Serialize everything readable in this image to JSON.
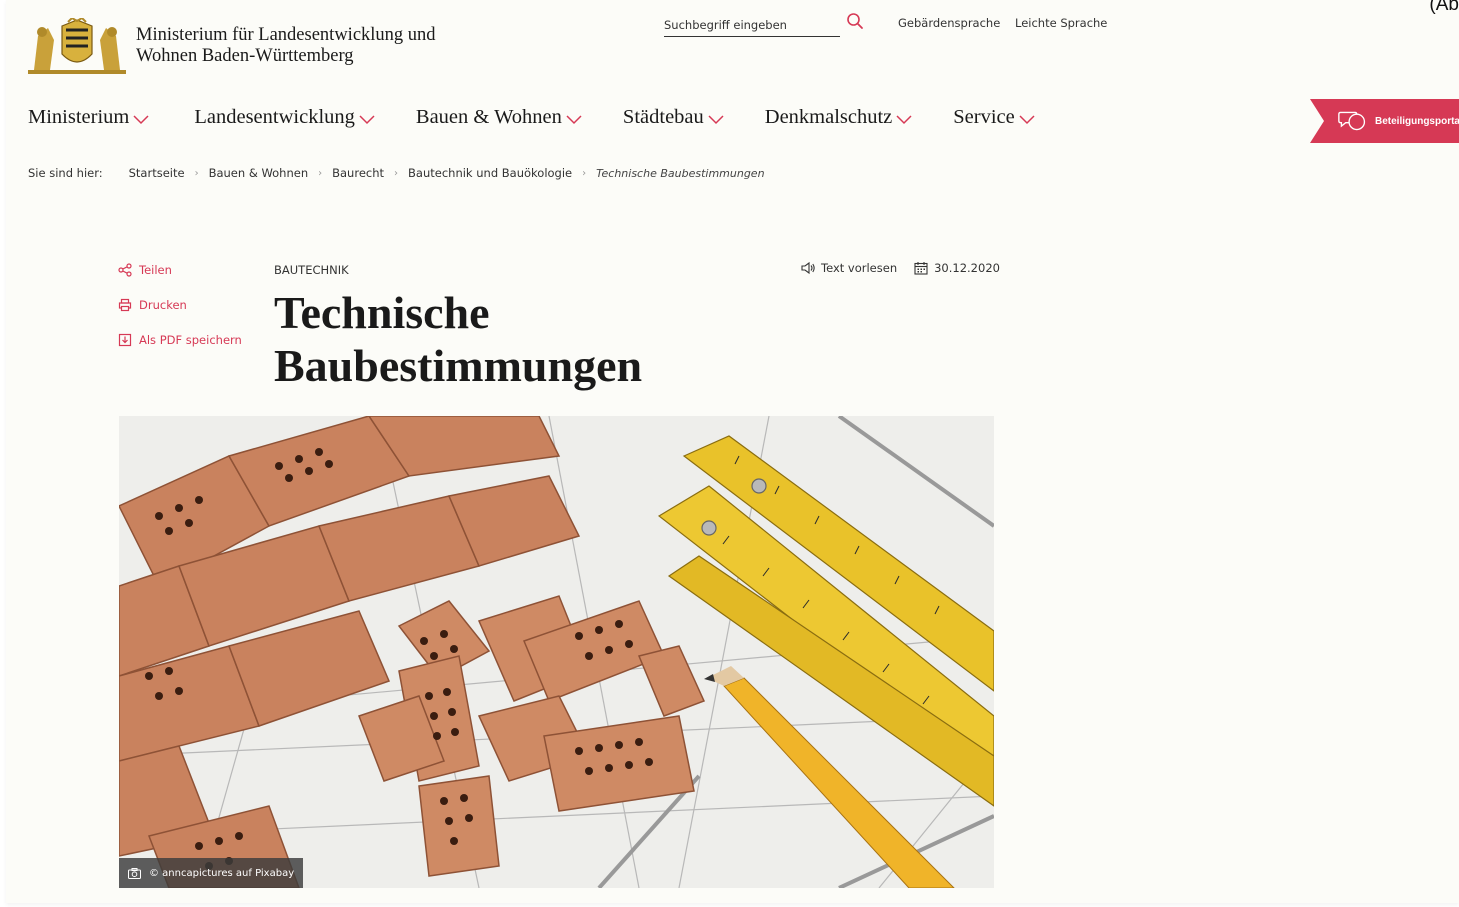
{
  "corner_text": "(Ab",
  "header": {
    "ministry_name_line1": "Ministerium für Landesentwicklung und",
    "ministry_name_line2": "Wohnen Baden-Württemberg",
    "search_placeholder": "Suchbegriff eingeben",
    "search_icon": "search-icon",
    "links": [
      "Gebärdensprache",
      "Leichte Sprache"
    ]
  },
  "nav": {
    "items": [
      {
        "label": "Ministerium"
      },
      {
        "label": "Landesentwicklung"
      },
      {
        "label": "Bauen & Wohnen"
      },
      {
        "label": "Städtebau"
      },
      {
        "label": "Denkmalschutz"
      },
      {
        "label": "Service"
      }
    ],
    "portal": {
      "label": "Beteiligungsporta",
      "icon": "speech-bubbles-icon"
    }
  },
  "breadcrumb": {
    "prefix": "Sie sind hier:",
    "items": [
      "Startseite",
      "Bauen & Wohnen",
      "Baurecht",
      "Bautechnik und Bauökologie"
    ],
    "current": "Technische Baubestimmungen"
  },
  "actions": {
    "share": "Teilen",
    "print": "Drucken",
    "pdf": "Als PDF speichern"
  },
  "article": {
    "kicker": "BAUTECHNIK",
    "title_line1": "Technische",
    "title_line2": "Baubestimmungen",
    "read_aloud": "Text vorlesen",
    "date": "30.12.2020",
    "image_credit": "© anncapictures auf Pixabay"
  },
  "colors": {
    "accent": "#d63955",
    "background": "#fcfcf8",
    "text": "#1a1a1a"
  }
}
